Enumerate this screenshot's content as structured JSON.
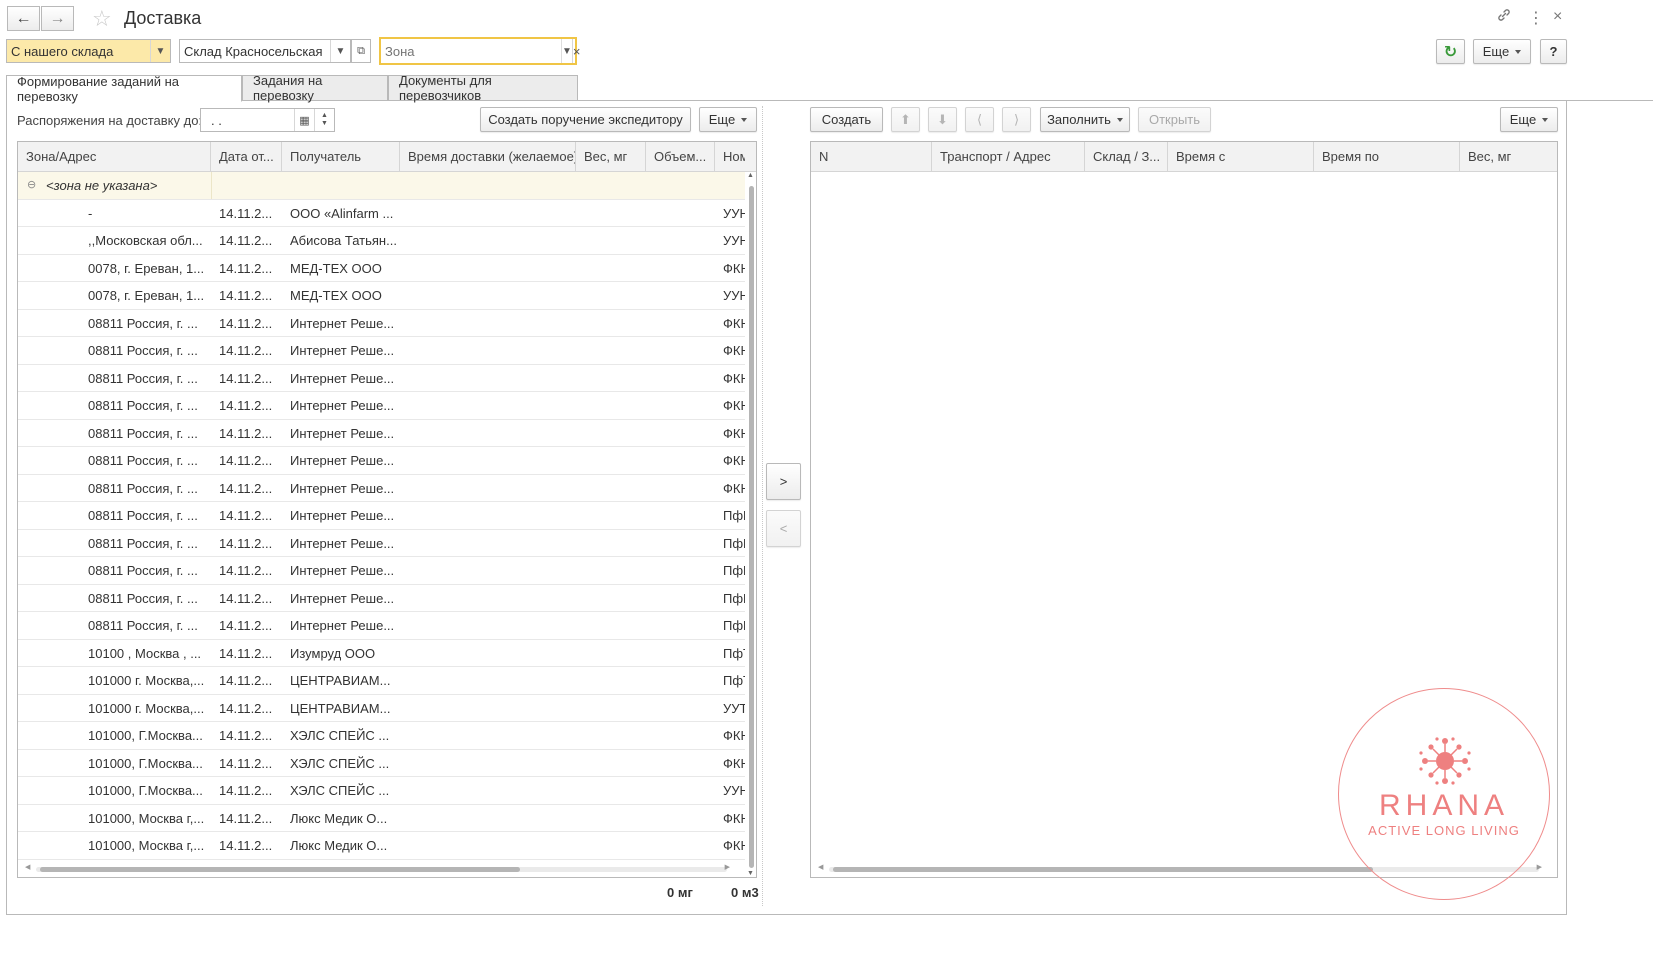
{
  "window": {
    "title": "Доставка"
  },
  "filters": {
    "source": "С нашего склада",
    "warehouse": "Склад Красносельская",
    "zone_placeholder": "Зона"
  },
  "header_buttons": {
    "more": "Еще",
    "help": "?"
  },
  "tabs": [
    {
      "label": "Формирование заданий на перевозку",
      "active": true
    },
    {
      "label": "Задания на перевозку",
      "active": false
    },
    {
      "label": "Документы для перевозчиков",
      "active": false
    }
  ],
  "left": {
    "date_label": "Распоряжения на доставку до:",
    "date_value": " .  .",
    "create_order_button": "Создать поручение экспедитору",
    "more": "Еще",
    "columns": [
      "Зона/Адрес",
      "Дата от...",
      "Получатель",
      "Время доставки (желаемое)",
      "Вес, мг",
      "Объем...",
      "Ном"
    ],
    "group_label": "<зона не указана>",
    "rows": [
      {
        "address": "-",
        "date": "14.11.2...",
        "recipient": "ООО «Alinfarm ...",
        "nom": "УУН"
      },
      {
        "address": ",,Московская обл...",
        "date": "14.11.2...",
        "recipient": "Абисова Татьян...",
        "nom": "УУН"
      },
      {
        "address": "0078, г. Ереван, 1...",
        "date": "14.11.2...",
        "recipient": "МЕД-ТЕХ ООО",
        "nom": "ФКН"
      },
      {
        "address": "0078, г. Ереван, 1...",
        "date": "14.11.2...",
        "recipient": "МЕД-ТЕХ ООО",
        "nom": "УУН"
      },
      {
        "address": "08811 Россия, г. ...",
        "date": "14.11.2...",
        "recipient": "Интернет Реше...",
        "nom": "ФКН"
      },
      {
        "address": "08811 Россия, г. ...",
        "date": "14.11.2...",
        "recipient": "Интернет Реше...",
        "nom": "ФКН"
      },
      {
        "address": "08811 Россия, г. ...",
        "date": "14.11.2...",
        "recipient": "Интернет Реше...",
        "nom": "ФКН"
      },
      {
        "address": "08811 Россия, г. ...",
        "date": "14.11.2...",
        "recipient": "Интернет Реше...",
        "nom": "ФКН"
      },
      {
        "address": "08811 Россия, г. ...",
        "date": "14.11.2...",
        "recipient": "Интернет Реше...",
        "nom": "ФКН"
      },
      {
        "address": "08811 Россия, г. ...",
        "date": "14.11.2...",
        "recipient": "Интернет Реше...",
        "nom": "ФКН"
      },
      {
        "address": "08811 Россия, г. ...",
        "date": "14.11.2...",
        "recipient": "Интернет Реше...",
        "nom": "ФКН"
      },
      {
        "address": "08811 Россия, г. ...",
        "date": "14.11.2...",
        "recipient": "Интернет Реше...",
        "nom": "ПфН"
      },
      {
        "address": "08811 Россия, г. ...",
        "date": "14.11.2...",
        "recipient": "Интернет Реше...",
        "nom": "ПфН"
      },
      {
        "address": "08811 Россия, г. ...",
        "date": "14.11.2...",
        "recipient": "Интернет Реше...",
        "nom": "ПфН"
      },
      {
        "address": "08811 Россия, г. ...",
        "date": "14.11.2...",
        "recipient": "Интернет Реше...",
        "nom": "ПфН"
      },
      {
        "address": "08811 Россия, г. ...",
        "date": "14.11.2...",
        "recipient": "Интернет Реше...",
        "nom": "ПфН"
      },
      {
        "address": "10100 , Москва ,  ...",
        "date": "14.11.2...",
        "recipient": "Изумруд ООО",
        "nom": "ПфТ"
      },
      {
        "address": "101000 г. Москва,...",
        "date": "14.11.2...",
        "recipient": "ЦЕНТРАВИАМ...",
        "nom": "ПфТ"
      },
      {
        "address": "101000 г. Москва,...",
        "date": "14.11.2...",
        "recipient": "ЦЕНТРАВИАМ...",
        "nom": "УУТ"
      },
      {
        "address": "101000, Г.Москва...",
        "date": "14.11.2...",
        "recipient": "ХЭЛС СПЕЙС ...",
        "nom": "ФКН"
      },
      {
        "address": "101000, Г.Москва...",
        "date": "14.11.2...",
        "recipient": "ХЭЛС СПЕЙС ...",
        "nom": "ФКН"
      },
      {
        "address": "101000, Г.Москва...",
        "date": "14.11.2...",
        "recipient": "ХЭЛС СПЕЙС ...",
        "nom": "УУН"
      },
      {
        "address": "101000, Москва г,...",
        "date": "14.11.2...",
        "recipient": "Люкс Медик О...",
        "nom": "ФКН"
      },
      {
        "address": "101000, Москва г,...",
        "date": "14.11.2...",
        "recipient": "Люкс Медик О...",
        "nom": "ФКН"
      }
    ],
    "total_weight": "0 мг",
    "total_volume": "0 м3"
  },
  "transfer": {
    "forward": ">",
    "back": "<"
  },
  "right": {
    "create": "Создать",
    "fill": "Заполнить",
    "open": "Открыть",
    "more": "Еще",
    "columns": [
      "N",
      "Транспорт / Адрес",
      "Склад / З...",
      "Время с",
      "Время по",
      "Вес, мг"
    ]
  },
  "watermark": {
    "brand": "RHANA",
    "tagline": "ACTIVE LONG LIVING"
  }
}
